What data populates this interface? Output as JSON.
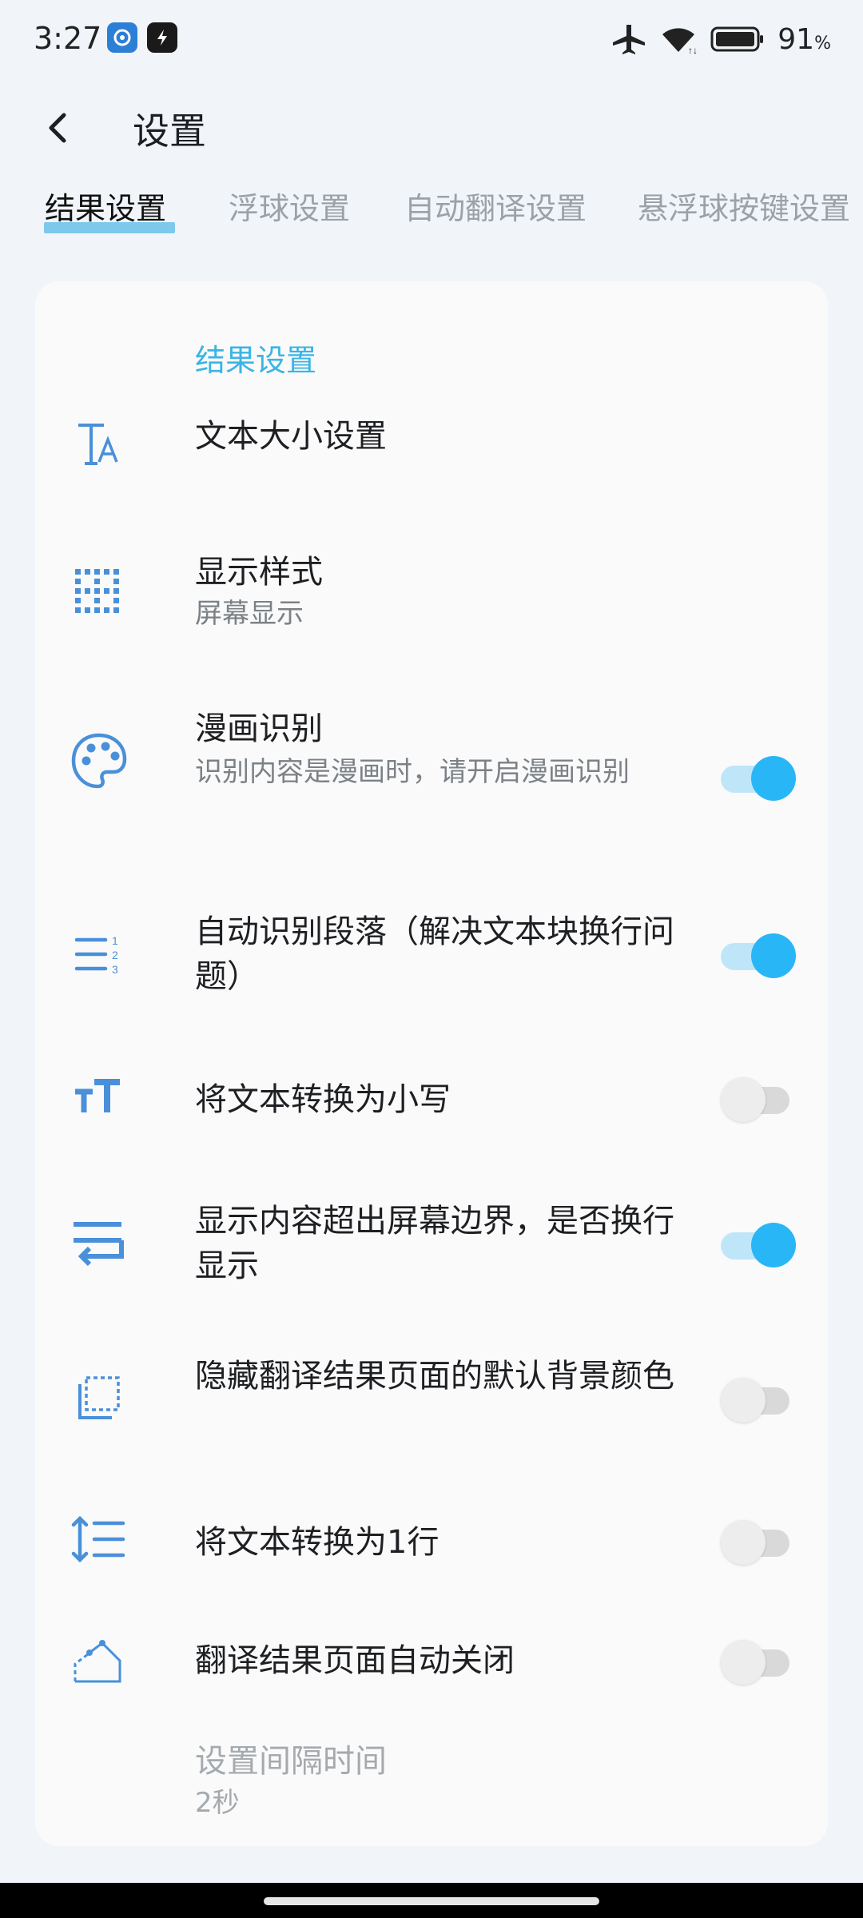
{
  "status_bar": {
    "time": "3:27",
    "battery_percent": "91",
    "battery_unit": "%",
    "icons": [
      "app-notification-icon",
      "app-notification-icon",
      "airplane-mode-icon",
      "wifi-icon",
      "battery-icon"
    ]
  },
  "header": {
    "title": "设置",
    "back_icon": "back-arrow-icon"
  },
  "tabs": [
    {
      "label": "结果设置",
      "active": true
    },
    {
      "label": "浮球设置",
      "active": false
    },
    {
      "label": "自动翻译设置",
      "active": false
    },
    {
      "label": "悬浮球按键设置",
      "active": false
    }
  ],
  "section": {
    "title": "结果设置"
  },
  "settings": [
    {
      "title": "文本大小设置",
      "icon": "text-size-icon"
    },
    {
      "title": "显示样式",
      "subtitle": "屏幕显示",
      "icon": "grid-dots-icon"
    },
    {
      "title": "漫画识别",
      "subtitle": "识别内容是漫画时，请开启漫画识别",
      "icon": "palette-icon",
      "toggle": true
    },
    {
      "title": "自动识别段落（解决文本块换行问题）",
      "icon": "numbered-list-icon",
      "toggle": true
    },
    {
      "title": "将文本转换为小写",
      "icon": "lowercase-icon",
      "toggle": false
    },
    {
      "title": "显示内容超出屏幕边界，是否换行显示",
      "icon": "wrap-text-icon",
      "toggle": true
    },
    {
      "title": "隐藏翻译结果页面的默认背景颜色",
      "icon": "background-icon",
      "toggle": false
    },
    {
      "title": "将文本转换为1行",
      "icon": "line-spacing-icon",
      "toggle": false
    },
    {
      "title": "翻译结果页面自动关闭",
      "icon": "auto-close-icon",
      "toggle": false
    },
    {
      "title": "设置间隔时间",
      "subtitle": "2秒",
      "disabled": true
    }
  ],
  "colors": {
    "accent": "#29b6f6",
    "icon": "#4a90d9",
    "section_title": "#3bb4e5"
  }
}
